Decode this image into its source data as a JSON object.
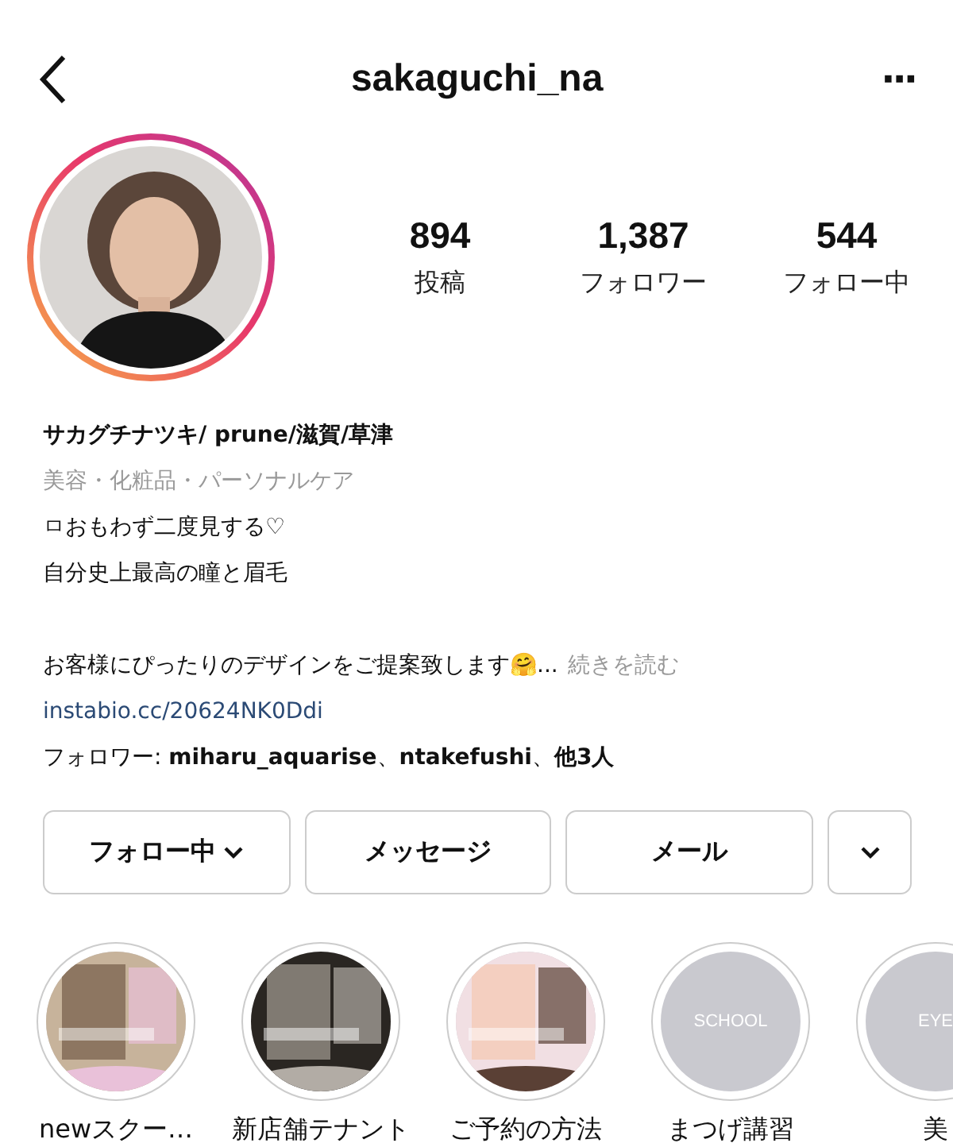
{
  "header": {
    "username": "sakaguchi_na",
    "more": "···"
  },
  "stats": [
    {
      "value": "894",
      "label": "投稿"
    },
    {
      "value": "1,387",
      "label": "フォロワー"
    },
    {
      "value": "544",
      "label": "フォロー中"
    }
  ],
  "bio": {
    "name": "サカグチナツキ/ prune/滋賀/草津",
    "category": "美容・化粧品・パーソナルケア",
    "paragraphs": [
      [
        "ㅁおもわず二度見する♡",
        "自分史上最高の瞳と眉毛"
      ],
      [
        "お客様にぴったりのデザインをご提案致します🤗..."
      ]
    ],
    "more": "続きを読む",
    "link": "instabio.cc/20624NK0Ddi",
    "followed_by": "フォロワー: **miharu_aquarise**、**ntakefushi**、**他3人**"
  },
  "buttons": [
    {
      "label": "フォロー中",
      "caret": true
    },
    {
      "label": "メッセージ",
      "caret": false
    },
    {
      "label": "メール",
      "caret": false
    },
    {
      "kind": "dropdown",
      "caret": true
    }
  ],
  "highlights": [
    {
      "kind": "picture",
      "label": "newスクー…"
    },
    {
      "kind": "picture",
      "label": "新店舗テナント"
    },
    {
      "kind": "picture",
      "label": "ご予約の方法"
    },
    {
      "kind": "text",
      "cover": "SCHOOL",
      "label": "まつげ講習"
    },
    {
      "kind": "text",
      "cover": "EYE",
      "label": "美"
    }
  ]
}
